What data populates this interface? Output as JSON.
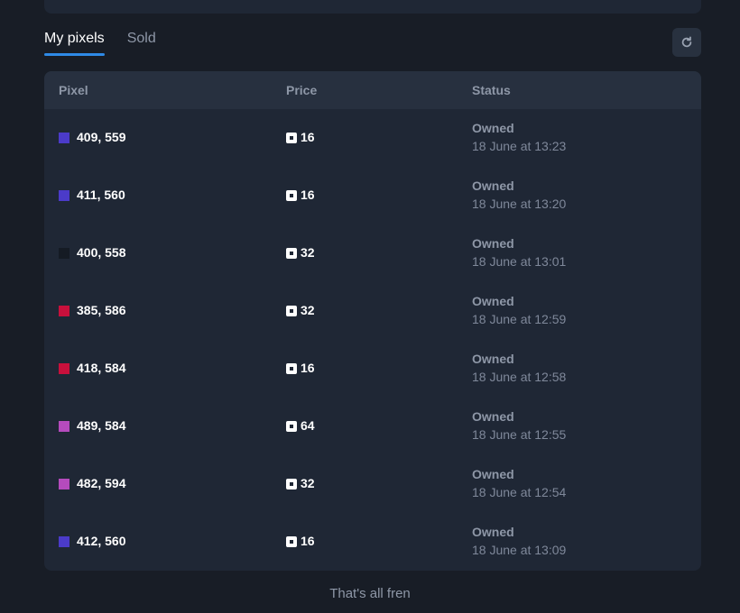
{
  "tabs": [
    {
      "label": "My pixels",
      "active": true
    },
    {
      "label": "Sold",
      "active": false
    }
  ],
  "refresh_icon": "refresh-icon",
  "table": {
    "headers": {
      "pixel": "Pixel",
      "price": "Price",
      "status": "Status"
    },
    "rows": [
      {
        "color": "#4b3bc9",
        "coords": "409, 559",
        "price": "16",
        "status": "Owned",
        "date": "18 June at 13:23"
      },
      {
        "color": "#4b3bc9",
        "coords": "411, 560",
        "price": "16",
        "status": "Owned",
        "date": "18 June at 13:20"
      },
      {
        "color": "#151b24",
        "coords": "400, 558",
        "price": "32",
        "status": "Owned",
        "date": "18 June at 13:01"
      },
      {
        "color": "#c8103c",
        "coords": "385, 586",
        "price": "32",
        "status": "Owned",
        "date": "18 June at 12:59"
      },
      {
        "color": "#c8103c",
        "coords": "418, 584",
        "price": "16",
        "status": "Owned",
        "date": "18 June at 12:58"
      },
      {
        "color": "#b54bbd",
        "coords": "489, 584",
        "price": "64",
        "status": "Owned",
        "date": "18 June at 12:55"
      },
      {
        "color": "#b54bbd",
        "coords": "482, 594",
        "price": "32",
        "status": "Owned",
        "date": "18 June at 12:54"
      },
      {
        "color": "#4b3bc9",
        "coords": "412, 560",
        "price": "16",
        "status": "Owned",
        "date": "18 June at 13:09"
      }
    ]
  },
  "footer_text": "That's all fren"
}
